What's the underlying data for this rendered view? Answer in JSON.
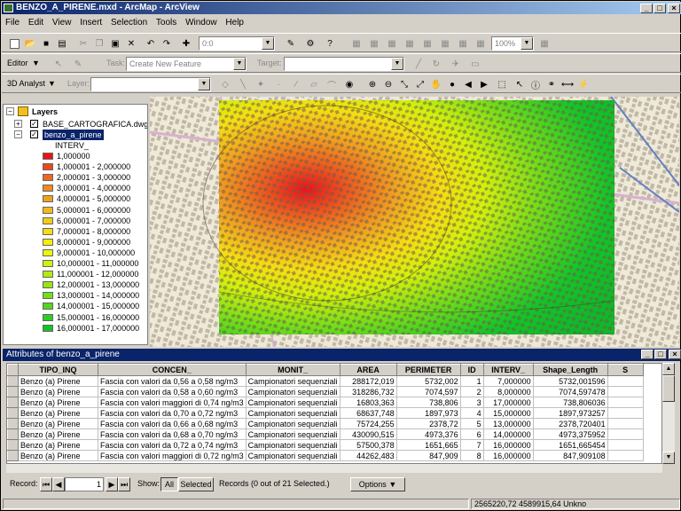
{
  "window": {
    "title": "BENZO_A_PIRENE.mxd - ArcMap - ArcView"
  },
  "menu": [
    "File",
    "Edit",
    "View",
    "Insert",
    "Selection",
    "Tools",
    "Window",
    "Help"
  ],
  "toolbar1": {
    "scale_value": "0:0",
    "zoom_value": "100%"
  },
  "editor": {
    "label": "Editor",
    "task_label": "Task:",
    "task_value": "Create New Feature",
    "target_label": "Target:"
  },
  "analyst": {
    "label": "3D Analyst",
    "layer_label": "Layer:"
  },
  "toc": {
    "root": "Layers",
    "layers": [
      "BASE_CARTOGRAFICA.dwg",
      "benzo_a_pirene"
    ],
    "field": "INTERV_",
    "legend": [
      {
        "label": "1,000000",
        "color": "#e8141c"
      },
      {
        "label": "1,000001 - 2,000000",
        "color": "#ea4a1c"
      },
      {
        "label": "2,000001 - 3,000000",
        "color": "#ec6a1e"
      },
      {
        "label": "3,000001 - 4,000000",
        "color": "#ef8a22"
      },
      {
        "label": "4,000001 - 5,000000",
        "color": "#f0a020"
      },
      {
        "label": "5,000001 - 6,000000",
        "color": "#f2b81c"
      },
      {
        "label": "6,000001 - 7,000000",
        "color": "#f4cc18"
      },
      {
        "label": "7,000001 - 8,000000",
        "color": "#f6dc12"
      },
      {
        "label": "8,000001 - 9,000000",
        "color": "#f8ec0c"
      },
      {
        "label": "9,000001 - 10,000000",
        "color": "#eef40a"
      },
      {
        "label": "10,000001 - 11,000000",
        "color": "#d2f00c"
      },
      {
        "label": "11,000001 - 12,000000",
        "color": "#b4ea10"
      },
      {
        "label": "12,000001 - 13,000000",
        "color": "#96e414"
      },
      {
        "label": "13,000001 - 14,000000",
        "color": "#76de18"
      },
      {
        "label": "14,000001 - 15,000000",
        "color": "#52d61e"
      },
      {
        "label": "15,000001 - 16,000000",
        "color": "#30cc22"
      },
      {
        "label": "16,000001 - 17,000000",
        "color": "#14c426"
      }
    ]
  },
  "attributes": {
    "title": "Attributes of benzo_a_pirene",
    "columns": [
      "TIPO_INQ",
      "CONCEN_",
      "MONIT_",
      "AREA",
      "PERIMETER",
      "ID",
      "INTERV_",
      "Shape_Length",
      "S"
    ],
    "rows": [
      [
        "Benzo (a) Pirene",
        "Fascia con valori da 0,56 a 0,58 ng/m3",
        "Campionatori sequenziali",
        "288172,019",
        "5732,002",
        "1",
        "7,000000",
        "5732,001596"
      ],
      [
        "Benzo (a) Pirene",
        "Fascia con valori da 0,58 a 0,60 ng/m3",
        "Campionatori sequenziali",
        "318286,732",
        "7074,597",
        "2",
        "8,000000",
        "7074,597478"
      ],
      [
        "Benzo (a) Pirene",
        "Fascia con valori maggiori di 0,74 ng/m3",
        "Campionatori sequenziali",
        "16803,363",
        "738,806",
        "3",
        "17,000000",
        "738,806036"
      ],
      [
        "Benzo (a) Pirene",
        "Fascia con valori da 0,70 a 0,72 ng/m3",
        "Campionatori sequenziali",
        "68637,748",
        "1897,973",
        "4",
        "15,000000",
        "1897,973257"
      ],
      [
        "Benzo (a) Pirene",
        "Fascia con valori da 0,66 a 0,68 ng/m3",
        "Campionatori sequenziali",
        "75724,255",
        "2378,72",
        "5",
        "13,000000",
        "2378,720401"
      ],
      [
        "Benzo (a) Pirene",
        "Fascia con valori da 0,68 a 0,70 ng/m3",
        "Campionatori sequenziali",
        "430090,515",
        "4973,376",
        "6",
        "14,000000",
        "4973,375952"
      ],
      [
        "Benzo (a) Pirene",
        "Fascia con valori da 0,72 a 0,74 ng/m3",
        "Campionatori sequenziali",
        "57500,378",
        "1651,665",
        "7",
        "16,000000",
        "1651,665454"
      ],
      [
        "Benzo (a) Pirene",
        "Fascia con valori maggiori di 0,72 ng/m3",
        "Campionatori sequenziali",
        "44262,483",
        "847,909",
        "8",
        "16,000000",
        "847,909108"
      ]
    ]
  },
  "records": {
    "label": "Record:",
    "current": "1",
    "show_label": "Show:",
    "all_label": "All",
    "selected_label": "Selected",
    "summary": "Records (0 out of 21 Selected.)",
    "options_label": "Options"
  },
  "status": {
    "coords": "2565220,72  4589915,64 Unkno"
  }
}
